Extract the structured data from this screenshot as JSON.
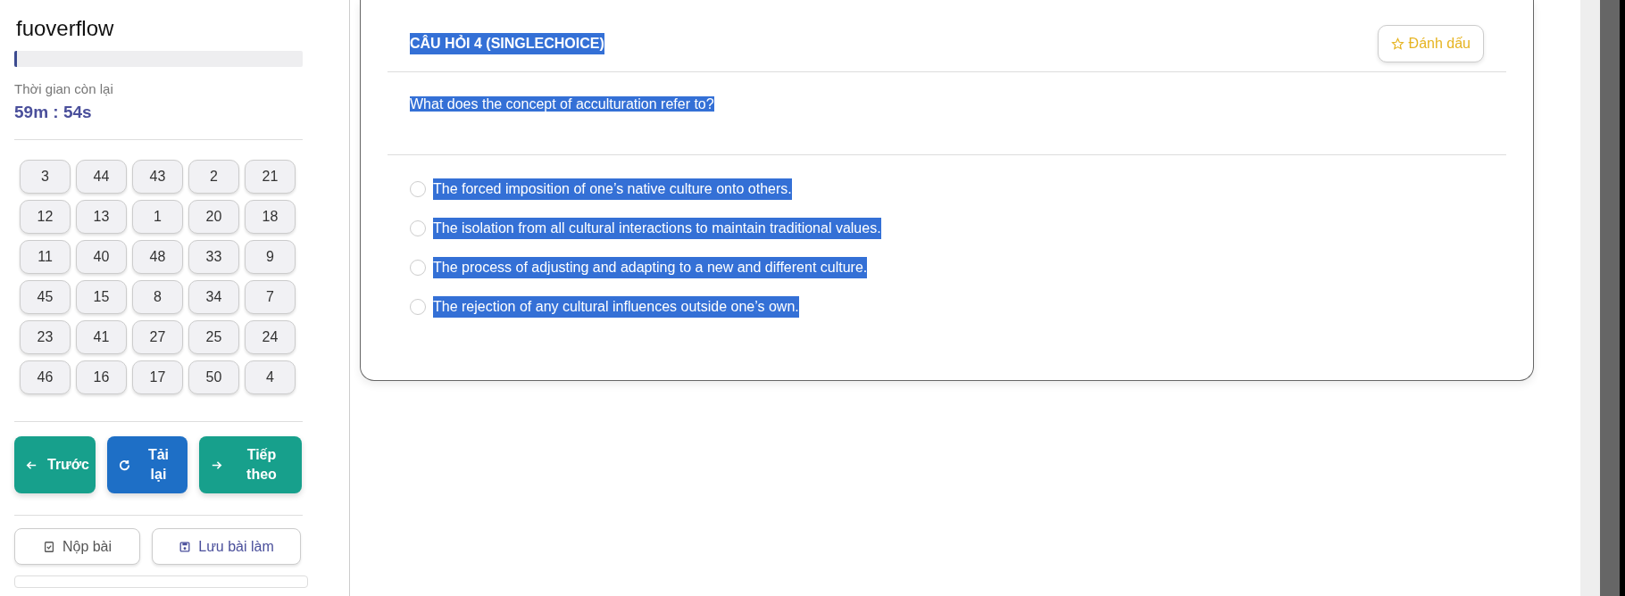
{
  "sidebar": {
    "title": "fuoverflow",
    "progress": {
      "level": 0.01
    },
    "timer_label": "Thời gian còn lại",
    "timer_value": "59m : 54s",
    "question_numbers": [
      "3",
      "44",
      "43",
      "2",
      "21",
      "12",
      "13",
      "1",
      "20",
      "18",
      "11",
      "40",
      "48",
      "33",
      "9",
      "45",
      "15",
      "8",
      "34",
      "7",
      "23",
      "41",
      "27",
      "25",
      "24",
      "46",
      "16",
      "17",
      "50",
      "4"
    ],
    "nav_buttons": [
      {
        "kind": "prev",
        "label": "Trước"
      },
      {
        "kind": "reload",
        "label": "Tải lại"
      },
      {
        "kind": "next",
        "label": "Tiếp theo"
      }
    ],
    "action_buttons": [
      {
        "kind": "submit",
        "label": "Nộp bài"
      },
      {
        "kind": "save",
        "label": "Lưu bài làm"
      }
    ]
  },
  "question": {
    "title": "CÂU HỎI 4 (SINGLECHOICE)",
    "title_highlighted": true,
    "bookmark_label": "Đánh dấu",
    "text": "What does the concept of acculturation refer to?",
    "text_highlighted": true,
    "options": [
      {
        "label": "The forced imposition of one’s native culture onto others.",
        "selected": false,
        "highlighted": true
      },
      {
        "label": "The isolation from all cultural interactions to maintain traditional values.",
        "selected": false,
        "highlighted": true
      },
      {
        "label": "The process of adjusting and adapting to a new and different culture.",
        "selected": false,
        "highlighted": true
      },
      {
        "label": "The rejection of any cultural influences outside one’s own.",
        "selected": false,
        "highlighted": true
      }
    ]
  }
}
